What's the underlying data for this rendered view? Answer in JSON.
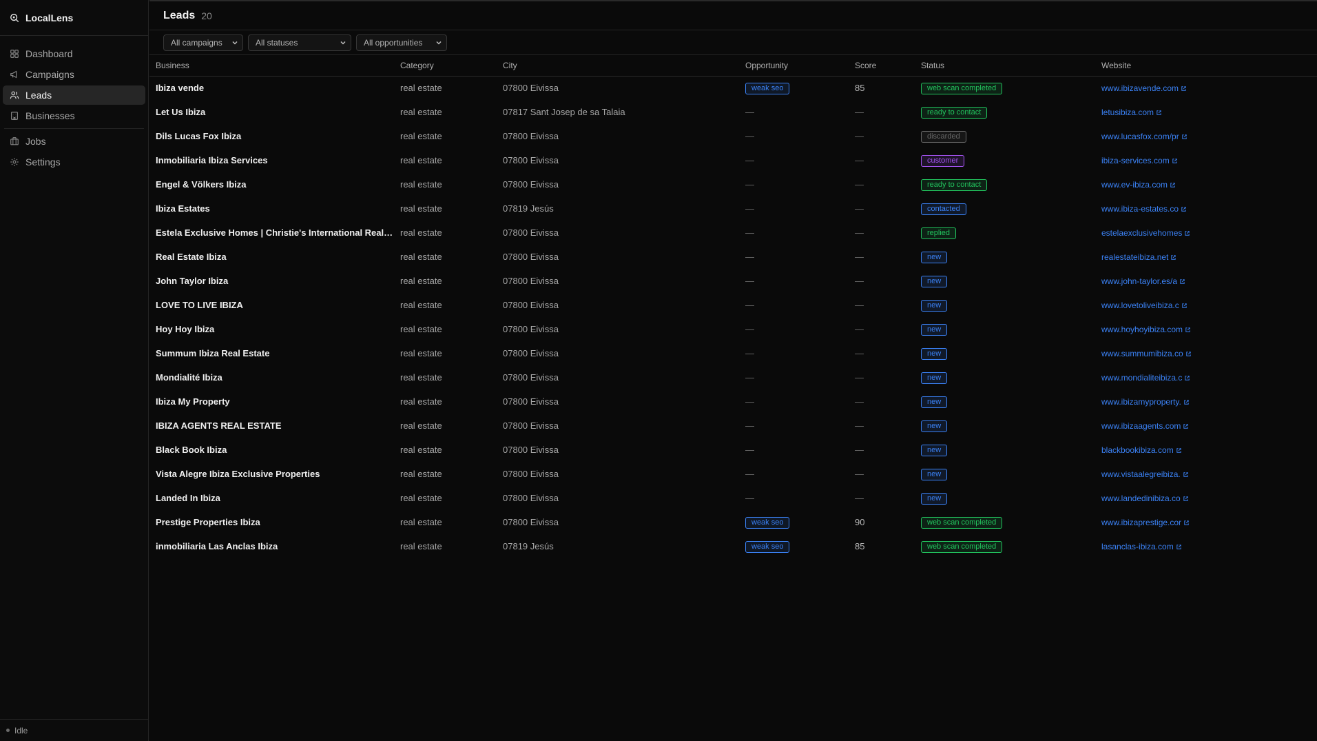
{
  "app": {
    "name": "LocalLens"
  },
  "nav": [
    {
      "label": "Dashboard",
      "icon": "dashboard-icon",
      "active": false
    },
    {
      "label": "Campaigns",
      "icon": "megaphone-icon",
      "active": false
    },
    {
      "label": "Leads",
      "icon": "users-icon",
      "active": true
    },
    {
      "label": "Businesses",
      "icon": "building-icon",
      "active": false
    },
    {
      "label": "Jobs",
      "icon": "briefcase-icon",
      "active": false
    },
    {
      "label": "Settings",
      "icon": "gear-icon",
      "active": false
    }
  ],
  "footer": {
    "status": "Idle"
  },
  "page": {
    "title": "Leads",
    "count": "20"
  },
  "filters": [
    {
      "label": "All campaigns"
    },
    {
      "label": "All statuses"
    },
    {
      "label": "All opportunities"
    }
  ],
  "table": {
    "columns": [
      "Business",
      "Category",
      "City",
      "Opportunity",
      "Score",
      "Status",
      "Website"
    ],
    "rows": [
      {
        "business": "Ibiza vende",
        "category": "real estate",
        "city": "07800 Eivissa",
        "opportunity": "weak seo",
        "score": "85",
        "status": "web scan completed",
        "website": "www.ibizavende.com"
      },
      {
        "business": "Let Us Ibiza",
        "category": "real estate",
        "city": "07817 Sant Josep de sa Talaia",
        "opportunity": "—",
        "score": "—",
        "status": "ready to contact",
        "website": "letusibiza.com"
      },
      {
        "business": "Dils Lucas Fox Ibiza",
        "category": "real estate",
        "city": "07800 Eivissa",
        "opportunity": "—",
        "score": "—",
        "status": "discarded",
        "website": "www.lucasfox.com/pr"
      },
      {
        "business": "Inmobiliaria Ibiza Services",
        "category": "real estate",
        "city": "07800 Eivissa",
        "opportunity": "—",
        "score": "—",
        "status": "customer",
        "website": "ibiza-services.com"
      },
      {
        "business": "Engel & Völkers Ibiza",
        "category": "real estate",
        "city": "07800 Eivissa",
        "opportunity": "—",
        "score": "—",
        "status": "ready to contact",
        "website": "www.ev-ibiza.com"
      },
      {
        "business": "Ibiza Estates",
        "category": "real estate",
        "city": "07819 Jesús",
        "opportunity": "—",
        "score": "—",
        "status": "contacted",
        "website": "www.ibiza-estates.co"
      },
      {
        "business": "Estela Exclusive Homes | Christie's International Real Estate",
        "category": "real estate",
        "city": "07800 Eivissa",
        "opportunity": "—",
        "score": "—",
        "status": "replied",
        "website": "estelaexclusivehomes"
      },
      {
        "business": "Real Estate Ibiza",
        "category": "real estate",
        "city": "07800 Eivissa",
        "opportunity": "—",
        "score": "—",
        "status": "new",
        "website": "realestateibiza.net"
      },
      {
        "business": "John Taylor Ibiza",
        "category": "real estate",
        "city": "07800 Eivissa",
        "opportunity": "—",
        "score": "—",
        "status": "new",
        "website": "www.john-taylor.es/a"
      },
      {
        "business": "LOVE TO LIVE IBIZA",
        "category": "real estate",
        "city": "07800 Eivissa",
        "opportunity": "—",
        "score": "—",
        "status": "new",
        "website": "www.lovetoliveibiza.c"
      },
      {
        "business": "Hoy Hoy Ibiza",
        "category": "real estate",
        "city": "07800 Eivissa",
        "opportunity": "—",
        "score": "—",
        "status": "new",
        "website": "www.hoyhoyibiza.com"
      },
      {
        "business": "Summum Ibiza Real Estate",
        "category": "real estate",
        "city": "07800 Eivissa",
        "opportunity": "—",
        "score": "—",
        "status": "new",
        "website": "www.summumibiza.co"
      },
      {
        "business": "Mondialité Ibiza",
        "category": "real estate",
        "city": "07800 Eivissa",
        "opportunity": "—",
        "score": "—",
        "status": "new",
        "website": "www.mondialiteibiza.c"
      },
      {
        "business": "Ibiza My Property",
        "category": "real estate",
        "city": "07800 Eivissa",
        "opportunity": "—",
        "score": "—",
        "status": "new",
        "website": "www.ibizamyproperty."
      },
      {
        "business": "IBIZA AGENTS REAL ESTATE",
        "category": "real estate",
        "city": "07800 Eivissa",
        "opportunity": "—",
        "score": "—",
        "status": "new",
        "website": "www.ibizaagents.com"
      },
      {
        "business": "Black Book Ibiza",
        "category": "real estate",
        "city": "07800 Eivissa",
        "opportunity": "—",
        "score": "—",
        "status": "new",
        "website": "blackbookibiza.com"
      },
      {
        "business": "Vista Alegre Ibiza Exclusive Properties",
        "category": "real estate",
        "city": "07800 Eivissa",
        "opportunity": "—",
        "score": "—",
        "status": "new",
        "website": "www.vistaalegreibiza."
      },
      {
        "business": "Landed In Ibiza",
        "category": "real estate",
        "city": "07800 Eivissa",
        "opportunity": "—",
        "score": "—",
        "status": "new",
        "website": "www.landedinibiza.co"
      },
      {
        "business": "Prestige Properties Ibiza",
        "category": "real estate",
        "city": "07800 Eivissa",
        "opportunity": "weak seo",
        "score": "90",
        "status": "web scan completed",
        "website": "www.ibizaprestige.cor"
      },
      {
        "business": "inmobiliaria Las Anclas Ibiza",
        "category": "real estate",
        "city": "07819 Jesús",
        "opportunity": "weak seo",
        "score": "85",
        "status": "web scan completed",
        "website": "lasanclas-ibiza.com"
      }
    ]
  },
  "colors": {
    "status": {
      "web scan completed": "#22c55e",
      "ready to contact": "#22c55e",
      "replied": "#22c55e",
      "discarded": "#6b6b6b",
      "customer": "#a855f7",
      "contacted": "#3b82f6",
      "new": "#3b82f6"
    },
    "opportunity": "#3b82f6",
    "link": "#3b82f6"
  }
}
